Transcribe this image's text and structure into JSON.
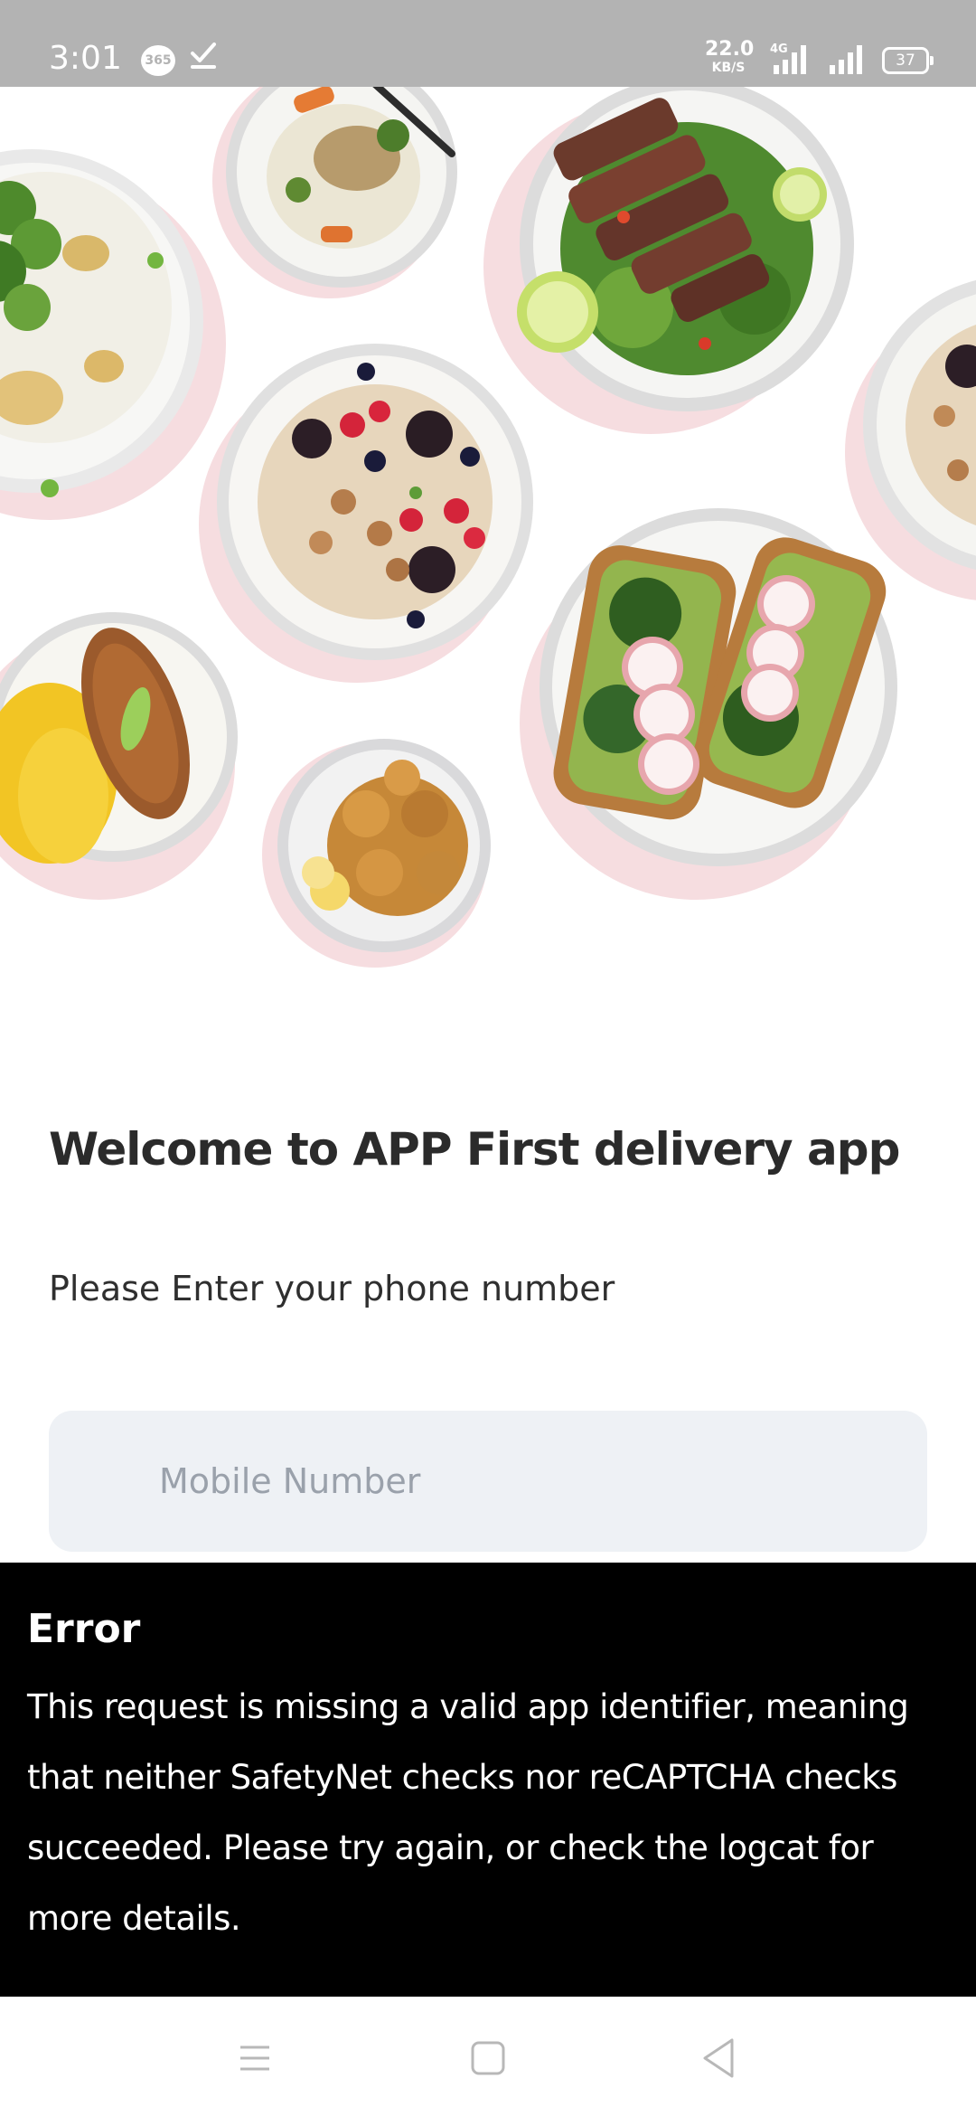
{
  "status_bar": {
    "time": "3:01",
    "badge_365": "365",
    "net_speed_value": "22.0",
    "net_speed_unit": "KB/S",
    "network_type": "4G",
    "battery_level": "37"
  },
  "hero": {
    "image_name": "food-dishes-collage"
  },
  "login": {
    "welcome_title": "Welcome to APP First delivery app",
    "prompt": "Please Enter your phone number",
    "phone_placeholder": "Mobile Number",
    "phone_value": ""
  },
  "error": {
    "title": "Error",
    "message": "This request is missing a valid app identifier, meaning that neither SafetyNet checks nor reCAPTCHA checks succeeded. Please try again, or check the logcat for more details."
  },
  "nav_bar": {
    "menu_icon": "menu-icon",
    "home_icon": "home-icon",
    "back_icon": "back-icon"
  },
  "colors": {
    "status_bar_bg": "#b3b3b3",
    "input_bg": "#eef1f5",
    "error_bg": "#000000",
    "plate_shadow": "#f6dde0"
  }
}
